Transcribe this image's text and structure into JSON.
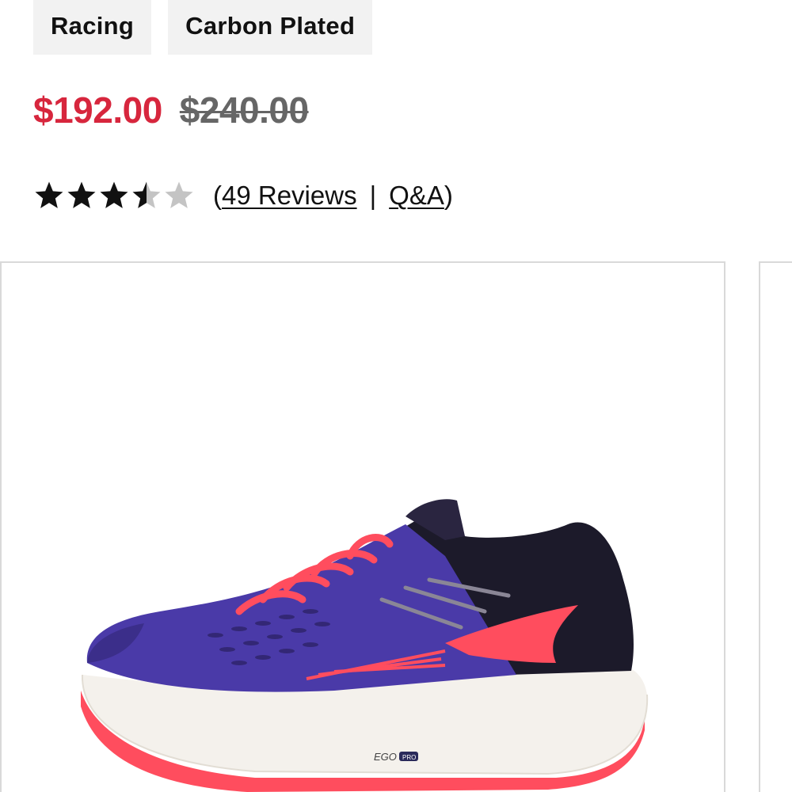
{
  "tags": [
    "Racing",
    "Carbon Plated"
  ],
  "price": {
    "sale": "$192.00",
    "original": "$240.00",
    "sale_color": "#d7263d"
  },
  "rating": {
    "value": 3.5,
    "max": 5,
    "open_paren": "(",
    "reviews_label": "49 Reviews",
    "separator": "|",
    "qa_label": "Q&A",
    "close_paren": ")"
  },
  "product_image": {
    "icon": "shoe-image",
    "sole_logo": "EGO",
    "sole_logo_suffix": "PRO",
    "colors": {
      "upper": "#4a3aa8",
      "heel": "#1c1a2a",
      "accent": "#ff4d5e",
      "sole": "#f4f1ec"
    }
  }
}
